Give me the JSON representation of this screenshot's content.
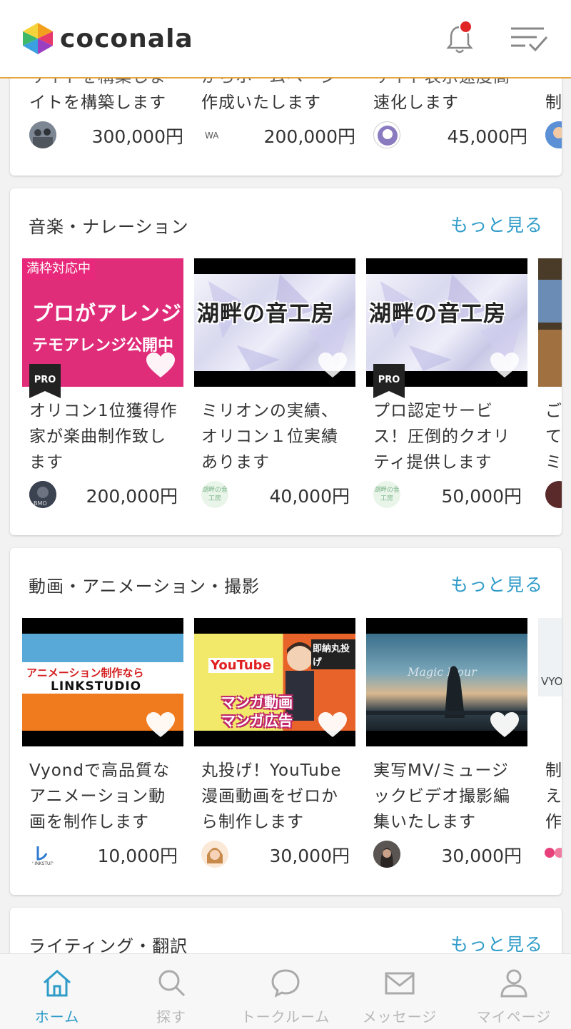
{
  "header": {
    "logo_text": "coconala",
    "accent_color": "#e5a640"
  },
  "partial_section": {
    "items": [
      {
        "title_tail": "イトを構築します",
        "price": "300,000円"
      },
      {
        "title_tail": "作成いたします",
        "price": "200,000円"
      },
      {
        "title_tail": "速化します",
        "price": "45,000円"
      },
      {
        "title_tail": "制"
      }
    ]
  },
  "sections": [
    {
      "title": "音楽・ナレーション",
      "more": "もっと見る",
      "items": [
        {
          "ribbon": "満枠対応中",
          "thumb_line1": "プロがアレンジ",
          "thumb_line2": "テモアレンジ公開中",
          "pro": "PRO",
          "title": "オリコン1位獲得作家が楽曲制作致します",
          "price": "200,000円"
        },
        {
          "thumb_line1": "湖畔の音工房",
          "avatar_text": "湖畔の音工房",
          "title": "ミリオンの実績、オリコン１位実績あります",
          "price": "40,000円"
        },
        {
          "thumb_line1": "湖畔の音工房",
          "pro": "PRO",
          "avatar_text": "湖畔の音工房",
          "title": "プロ認定サービス！圧倒的クオリティ提供します",
          "price": "50,000円"
        },
        {
          "title": "ごてミ"
        }
      ]
    },
    {
      "title": "動画・アニメーション・撮影",
      "more": "もっと見る",
      "items": [
        {
          "thumb_line1": "アニメーション制作なら",
          "thumb_line2": "LINKSTUDIO",
          "title": "Vyondで高品質なアニメーション動画を制作します",
          "price": "10,000円"
        },
        {
          "thumb_line1": "YouTube",
          "thumb_line2": "マンガ動画",
          "thumb_line3": "マンガ広告",
          "thumb_badge": "即納丸投げ",
          "title": "丸投げ！YouTube漫画動画をゼロから制作します",
          "price": "30,000円"
        },
        {
          "thumb_line1": "Magic Hour",
          "title": "実写MV/ミュージックビデオ撮影編集いたします",
          "price": "30,000円"
        },
        {
          "thumb_line1": "VYO",
          "title": "制え作"
        }
      ]
    },
    {
      "title": "ライティング・翻訳",
      "more": "もっと見る"
    }
  ],
  "bottom_nav": [
    {
      "label": "ホーム",
      "icon": "home-icon",
      "active": true
    },
    {
      "label": "探す",
      "icon": "search-icon"
    },
    {
      "label": "トークルーム",
      "icon": "chat-bubble-icon"
    },
    {
      "label": "メッセージ",
      "icon": "mail-icon"
    },
    {
      "label": "マイページ",
      "icon": "person-icon"
    }
  ]
}
